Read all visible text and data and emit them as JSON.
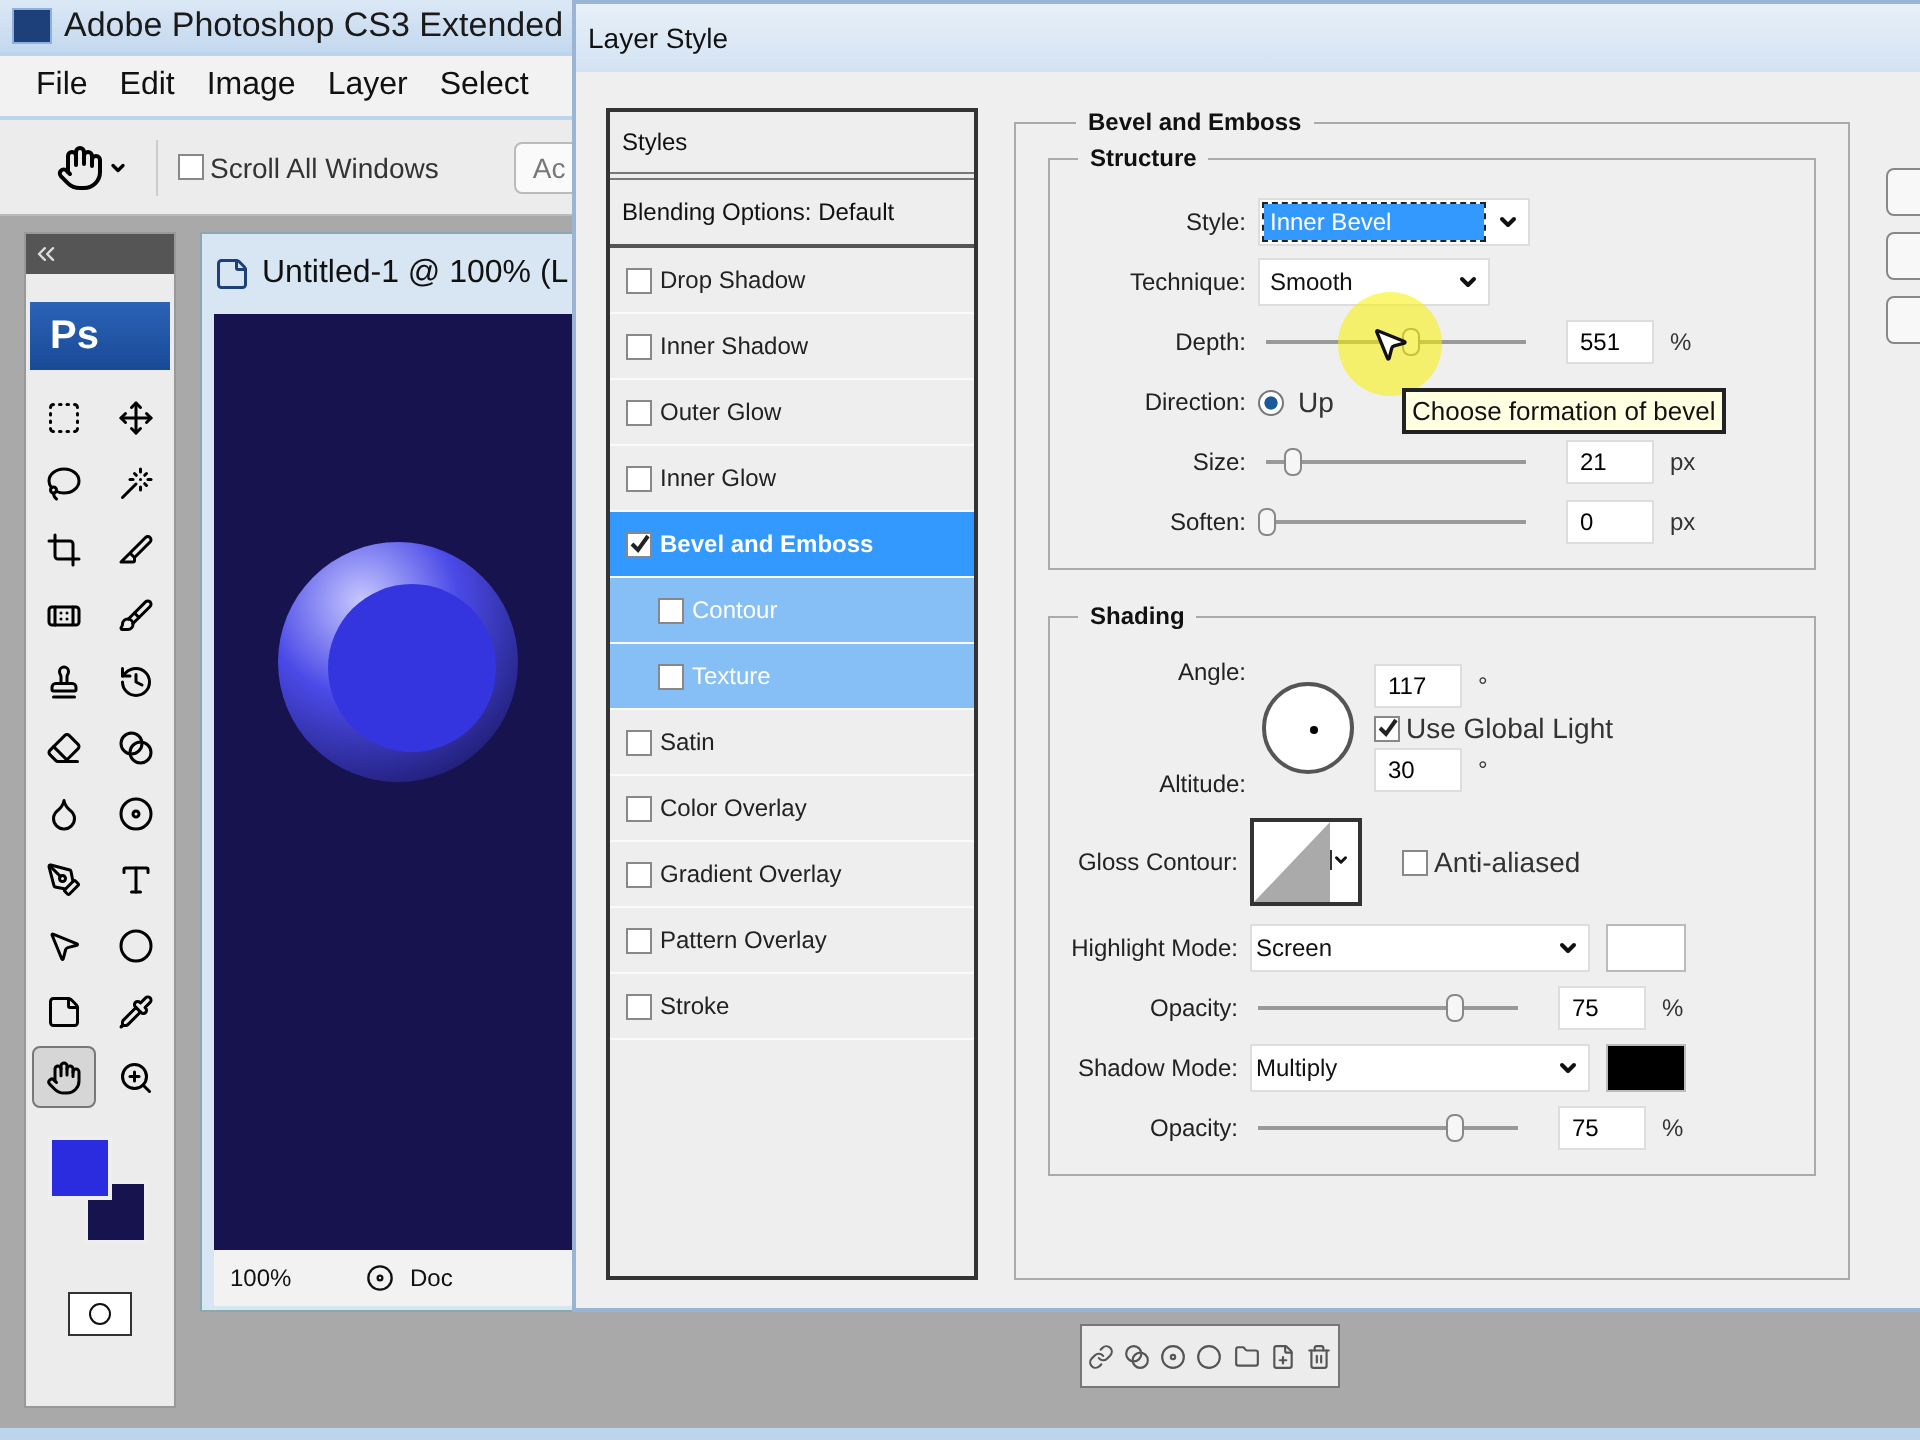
{
  "app": {
    "title": "Adobe Photoshop CS3 Extended",
    "menu": [
      "File",
      "Edit",
      "Image",
      "Layer",
      "Select"
    ]
  },
  "options_bar": {
    "scroll_all_windows": {
      "label": "Scroll All Windows",
      "checked": false
    },
    "cut_button": "Ac"
  },
  "toolbox": {
    "logo": "Ps",
    "tools": [
      {
        "selected": false
      },
      {
        "selected": false
      },
      {
        "selected": false
      },
      {
        "selected": false
      },
      {
        "selected": false
      },
      {
        "selected": false
      },
      {
        "selected": false
      },
      {
        "selected": false
      },
      {
        "selected": false
      },
      {
        "selected": false
      },
      {
        "selected": false
      },
      {
        "selected": false
      },
      {
        "selected": false
      },
      {
        "selected": false
      },
      {
        "selected": false
      },
      {
        "selected": false
      },
      {
        "selected": false
      },
      {
        "selected": false
      },
      {
        "selected": false
      },
      {
        "selected": false
      },
      {
        "selected": true
      },
      {
        "selected": false
      }
    ],
    "swatches": [
      {
        "color": "#2b2be0"
      },
      {
        "color": "#17134f"
      }
    ]
  },
  "document": {
    "title": "Untitled-1 @ 100% (L",
    "zoom": "100%",
    "status": "Doc"
  },
  "dialog": {
    "title": "Layer Style",
    "styles_header": "Styles",
    "blending": "Blending Options: Default",
    "effects": [
      {
        "label": "Drop Shadow",
        "checked": false,
        "selected": false
      },
      {
        "label": "Inner Shadow",
        "checked": false,
        "selected": false
      },
      {
        "label": "Outer Glow",
        "checked": false,
        "selected": false
      },
      {
        "label": "Inner Glow",
        "checked": false,
        "selected": false
      },
      {
        "label": "Bevel and Emboss",
        "checked": true,
        "selected": true,
        "children": [
          {
            "label": "Contour",
            "checked": false,
            "selected": false
          },
          {
            "label": "Texture",
            "checked": false,
            "selected": false
          }
        ]
      },
      {
        "label": "Satin",
        "checked": false,
        "selected": false
      },
      {
        "label": "Color Overlay",
        "checked": false,
        "selected": false
      },
      {
        "label": "Gradient Overlay",
        "checked": false,
        "selected": false
      },
      {
        "label": "Pattern Overlay",
        "checked": false,
        "selected": false
      },
      {
        "label": "Stroke",
        "checked": false,
        "selected": false
      }
    ],
    "panel": {
      "title": "Bevel and Emboss",
      "structure": {
        "title": "Structure",
        "rows": [
          {
            "kind": "select",
            "label": "Style:",
            "value": "Inner Bevel",
            "focused": true
          },
          {
            "kind": "select",
            "label": "Technique:",
            "value": "Smooth",
            "focused": false
          },
          {
            "kind": "slider",
            "label": "Depth:",
            "value": "551",
            "unit": "%",
            "level": 0.55
          },
          {
            "kind": "radio",
            "label": "Direction:",
            "options": [
              {
                "label": "Up",
                "selected": true
              }
            ]
          },
          {
            "kind": "slider",
            "label": "Size:",
            "value": "21",
            "unit": "px",
            "level": 0.1
          },
          {
            "kind": "slider",
            "label": "Soften:",
            "value": "0",
            "unit": "px",
            "level": 0
          }
        ]
      },
      "tooltip": "Choose formation of bevel",
      "shading": {
        "title": "Shading",
        "angle": {
          "label": "Angle:",
          "value": "117",
          "unit": "°"
        },
        "global_light": {
          "label": "Use Global Light",
          "checked": true
        },
        "altitude": {
          "label": "Altitude:",
          "value": "30",
          "unit": "°"
        },
        "gloss": {
          "label": "Gloss Contour:"
        },
        "anti_aliased": {
          "label": "Anti-aliased",
          "checked": false
        },
        "rows": [
          {
            "kind": "mode",
            "label": "Highlight Mode:",
            "value": "Screen",
            "color": "#ffffff"
          },
          {
            "kind": "slider",
            "label": "Opacity:",
            "value": "75",
            "unit": "%",
            "level": 0.75
          },
          {
            "kind": "mode",
            "label": "Shadow Mode:",
            "value": "Multiply",
            "color": "#000000"
          },
          {
            "kind": "slider",
            "label": "Opacity:",
            "value": "75",
            "unit": "%",
            "level": 0.75
          }
        ]
      }
    }
  }
}
